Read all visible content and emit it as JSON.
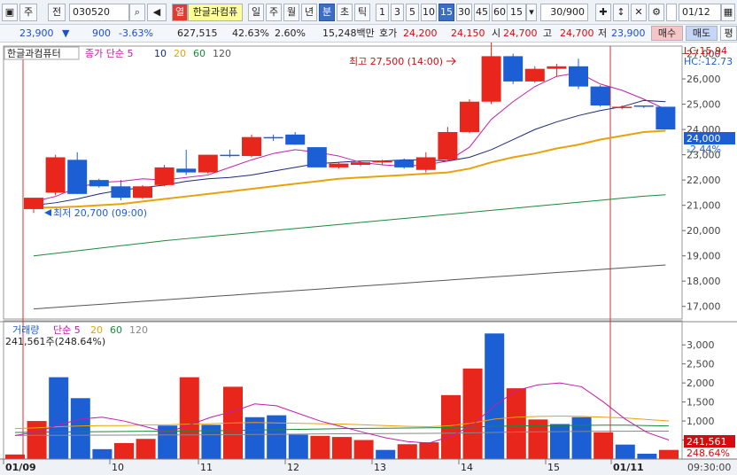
{
  "toolbar": {
    "market": "주",
    "market2": "전",
    "code": "030520",
    "name_badge": "열",
    "stock_name": "한글과컴퓨",
    "periods": [
      "일",
      "주",
      "월",
      "년",
      "분",
      "초",
      "틱"
    ],
    "active_period": "분",
    "intervals": [
      "1",
      "3",
      "5",
      "10",
      "15",
      "30",
      "45",
      "60"
    ],
    "active_interval": "15",
    "interval_select": "15",
    "count": "30/900",
    "date": "01/12"
  },
  "quote": {
    "price": "23,900",
    "change": "900",
    "change_pct": "-3.63%",
    "volume": "627,515",
    "volume_ratio": "42.63%",
    "turnover_pct": "2.60%",
    "amount": "15,248백만",
    "bid_label": "호가",
    "bid1": "24,200",
    "bid2": "24,150",
    "open_label": "시",
    "open": "24,700",
    "high_label": "고",
    "high": "24,700",
    "low_label": "저",
    "low": "23,900",
    "buy_label": "매수",
    "sell_label": "매도",
    "eval_label": "평"
  },
  "colors": {
    "up": "#e8261c",
    "down": "#1c5fd4",
    "ma5": "#c21ea8",
    "ma10": "#1a2a7a",
    "ma20": "#e8a20a",
    "ma60": "#1a8a3a",
    "ma120": "#555555",
    "vline": "#d43030"
  },
  "chart_data": [
    {
      "type": "candlestick",
      "title": "한글과컴퓨터",
      "legend": [
        "종가 단순 5",
        "10",
        "20",
        "60",
        "120"
      ],
      "ylim": [
        16500,
        27300
      ],
      "yticks": [
        17000,
        18000,
        19000,
        20000,
        21000,
        22000,
        23000,
        24000,
        25000,
        26000,
        27000
      ],
      "ytick_labels": [
        "17,000",
        "18,000",
        "19,000",
        "20,000",
        "21,000",
        "22,000",
        "23,000",
        "24,000",
        "25,000",
        "26,000",
        "27,000"
      ],
      "candles": [
        {
          "o": 20850,
          "h": 21200,
          "l": 20700,
          "c": 21300
        },
        {
          "o": 21500,
          "h": 23000,
          "l": 21400,
          "c": 22900
        },
        {
          "o": 22800,
          "h": 23100,
          "l": 21450,
          "c": 21450
        },
        {
          "o": 22000,
          "h": 22050,
          "l": 21700,
          "c": 21750
        },
        {
          "o": 21750,
          "h": 22000,
          "l": 21200,
          "c": 21300
        },
        {
          "o": 21300,
          "h": 21800,
          "l": 21250,
          "c": 21750
        },
        {
          "o": 21800,
          "h": 22600,
          "l": 21750,
          "c": 22500
        },
        {
          "o": 22450,
          "h": 23200,
          "l": 22200,
          "c": 22300
        },
        {
          "o": 22300,
          "h": 23000,
          "l": 22250,
          "c": 23000
        },
        {
          "o": 23000,
          "h": 23200,
          "l": 22900,
          "c": 22950
        },
        {
          "o": 22950,
          "h": 23800,
          "l": 22900,
          "c": 23700
        },
        {
          "o": 23700,
          "h": 23800,
          "l": 23550,
          "c": 23650
        },
        {
          "o": 23800,
          "h": 23900,
          "l": 23400,
          "c": 23400
        },
        {
          "o": 23300,
          "h": 23300,
          "l": 22500,
          "c": 22500
        },
        {
          "o": 22500,
          "h": 22700,
          "l": 22450,
          "c": 22650
        },
        {
          "o": 22600,
          "h": 22750,
          "l": 22550,
          "c": 22700
        },
        {
          "o": 22700,
          "h": 22800,
          "l": 22600,
          "c": 22750
        },
        {
          "o": 22800,
          "h": 22850,
          "l": 22450,
          "c": 22500
        },
        {
          "o": 22400,
          "h": 23100,
          "l": 22300,
          "c": 22900
        },
        {
          "o": 22800,
          "h": 24100,
          "l": 22750,
          "c": 23900
        },
        {
          "o": 23900,
          "h": 25200,
          "l": 23850,
          "c": 25100
        },
        {
          "o": 25100,
          "h": 27500,
          "l": 25000,
          "c": 26900
        },
        {
          "o": 26900,
          "h": 27000,
          "l": 25800,
          "c": 25900
        },
        {
          "o": 25900,
          "h": 26500,
          "l": 25850,
          "c": 26400
        },
        {
          "o": 26400,
          "h": 26600,
          "l": 26100,
          "c": 26500
        },
        {
          "o": 26500,
          "h": 26800,
          "l": 25600,
          "c": 25700
        },
        {
          "o": 25700,
          "h": 25750,
          "l": 24900,
          "c": 24950
        },
        {
          "o": 24900,
          "h": 24950,
          "l": 24800,
          "c": 24900
        },
        {
          "o": 24950,
          "h": 24950,
          "l": 24850,
          "c": 24900
        },
        {
          "o": 24900,
          "h": 24900,
          "l": 24000,
          "c": 24000
        }
      ],
      "ma5": [
        21150,
        21350,
        21700,
        21900,
        21950,
        22050,
        22000,
        22100,
        22200,
        22500,
        22800,
        23050,
        23200,
        23100,
        22950,
        22700,
        22600,
        22550,
        22600,
        22750,
        23300,
        24400,
        25100,
        25700,
        26100,
        26250,
        25800,
        25550,
        25200,
        24800
      ],
      "ma10": [
        21000,
        21100,
        21250,
        21450,
        21600,
        21700,
        21800,
        21950,
        22050,
        22100,
        22200,
        22350,
        22500,
        22650,
        22700,
        22750,
        22750,
        22800,
        22800,
        22750,
        22900,
        23200,
        23600,
        24000,
        24300,
        24550,
        24750,
        24900,
        25150,
        25100
      ],
      "ma20": [
        20900,
        20920,
        20950,
        21000,
        21050,
        21150,
        21250,
        21350,
        21450,
        21550,
        21650,
        21750,
        21850,
        21950,
        22050,
        22100,
        22150,
        22200,
        22250,
        22300,
        22450,
        22700,
        22900,
        23050,
        23250,
        23400,
        23600,
        23750,
        23900,
        23950
      ],
      "ma60": [
        19000,
        19100,
        19200,
        19300,
        19400,
        19500,
        19600,
        19680,
        19760,
        19840,
        19920,
        20000,
        20080,
        20160,
        20240,
        20320,
        20400,
        20480,
        20560,
        20640,
        20720,
        20800,
        20880,
        20960,
        21040,
        21120,
        21200,
        21280,
        21360,
        21420
      ],
      "ma120": [
        16900,
        16960,
        17020,
        17080,
        17140,
        17200,
        17260,
        17320,
        17380,
        17440,
        17500,
        17560,
        17620,
        17680,
        17740,
        17800,
        17860,
        17920,
        17980,
        18040,
        18100,
        18160,
        18220,
        18280,
        18340,
        18400,
        18460,
        18520,
        18580,
        18640
      ],
      "annotations": {
        "high": "최고 27,500 (14:00)",
        "low": "최저 20,700 (09:00)"
      },
      "right_labels": {
        "lc": "LC:15.94",
        "hc": "HC:-12.73",
        "last_price": "24,000",
        "last_pct": "-2.44%"
      }
    },
    {
      "type": "bar",
      "title": "거래량",
      "legend": [
        "단순 5",
        "20",
        "60",
        "120"
      ],
      "summary": "241,561주(248.64%)",
      "ylim": [
        0,
        3400
      ],
      "yticks": [
        500,
        1000,
        1500,
        2000,
        2500,
        3000
      ],
      "ytick_labels": [
        "500",
        "1,000",
        "1,500",
        "2,000",
        "2,500",
        "3,000"
      ],
      "unit": "K",
      "volumes": [
        120,
        1000,
        2150,
        1600,
        260,
        420,
        530,
        880,
        2150,
        900,
        1900,
        1100,
        1150,
        640,
        610,
        580,
        500,
        240,
        390,
        440,
        1680,
        2380,
        3300,
        1860,
        1040,
        920,
        1100,
        700,
        380,
        140,
        240
      ],
      "ma5": [
        620,
        710,
        900,
        1050,
        1100,
        1000,
        850,
        700,
        900,
        1100,
        1250,
        1450,
        1400,
        1200,
        1000,
        850,
        700,
        560,
        460,
        420,
        600,
        900,
        1400,
        1800,
        1950,
        2000,
        1900,
        1500,
        1050,
        700,
        500
      ],
      "ma20": [
        800,
        820,
        850,
        870,
        880,
        880,
        900,
        900,
        920,
        930,
        950,
        960,
        950,
        940,
        930,
        920,
        900,
        880,
        860,
        850,
        880,
        950,
        1050,
        1100,
        1120,
        1130,
        1120,
        1100,
        1080,
        1040,
        1000
      ],
      "ma60": [
        700,
        705,
        710,
        715,
        720,
        725,
        730,
        735,
        740,
        745,
        750,
        760,
        770,
        780,
        790,
        800,
        805,
        810,
        815,
        820,
        830,
        840,
        860,
        870,
        875,
        880,
        885,
        890,
        890,
        880,
        870
      ],
      "ma120": [
        620,
        622,
        624,
        626,
        628,
        630,
        632,
        634,
        636,
        638,
        640,
        645,
        650,
        655,
        660,
        665,
        668,
        670,
        672,
        675,
        680,
        690,
        700,
        710,
        715,
        720,
        725,
        730,
        732,
        733,
        734
      ],
      "right_labels": {
        "last_volume": "241,561",
        "last_pct": "248.64%"
      }
    }
  ],
  "xaxis": {
    "labels": [
      "01/09",
      "10",
      "11",
      "12",
      "13",
      "14",
      "15",
      "01/11"
    ],
    "time": "09:30:00"
  }
}
